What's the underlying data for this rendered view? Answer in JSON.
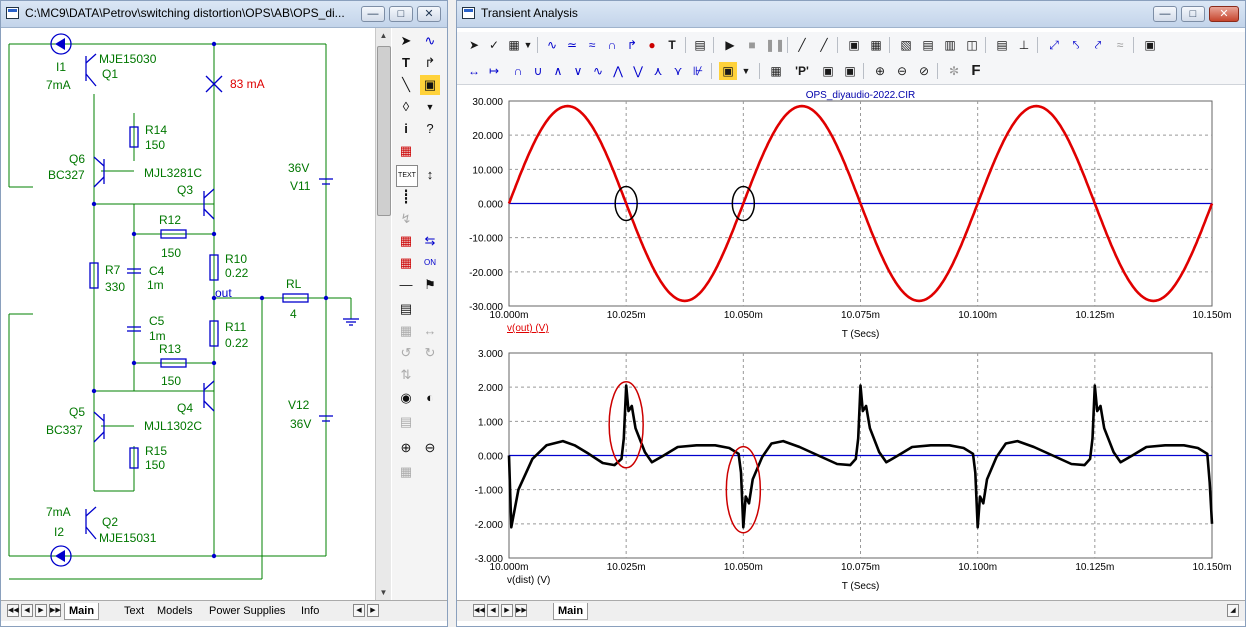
{
  "schematic_window": {
    "title": "C:\\MC9\\DATA\\Petrov\\switching distortion\\OPS\\AB\\OPS_di...",
    "labels": {
      "q1_type": "MJE15030",
      "q1_name": "Q1",
      "i1_name": "I1",
      "i1_value": "7mA",
      "meas_current": "83 mA",
      "r14_name": "R14",
      "r14_value": "150",
      "q6_name": "Q6",
      "q6_type": "BC327",
      "q3_type": "MJL3281C",
      "q3_name": "Q3",
      "v11_value": "36V",
      "v11_name": "V11",
      "r12_name": "R12",
      "r12_value": "150",
      "r10_name": "R10",
      "r10_value": "0.22",
      "r7_name": "R7",
      "r7_value": "330",
      "c4_name": "C4",
      "c4_value": "1m",
      "out_label": "out",
      "rl_name": "RL",
      "rl_value": "4",
      "c5_name": "C5",
      "c5_value": "1m",
      "r11_name": "R11",
      "r11_value": "0.22",
      "r13_name": "R13",
      "r13_value": "150",
      "q4_name": "Q4",
      "q4_type": "MJL1302C",
      "v12_name": "V12",
      "v12_value": "36V",
      "q5_name": "Q5",
      "q5_type": "BC337",
      "r15_name": "R15",
      "r15_value": "150",
      "i2_value": "7mA",
      "i2_name": "I2",
      "q2_name": "Q2",
      "q2_type": "MJE15031"
    },
    "tabs": [
      "Main",
      "Text",
      "Models",
      "Power Supplies",
      "Info"
    ],
    "palette_text_label": "TEXT"
  },
  "analysis_window": {
    "title": "Transient Analysis",
    "tabs": [
      "Main"
    ],
    "toolbar_font_icon": "F",
    "toolbar_p_icon": "'P'"
  },
  "colors": {
    "trace_out": "#e00000",
    "trace_dist": "#000000",
    "axis_zero": "#0000cc",
    "grid": "#999999",
    "schematic_wire": "#008000",
    "schematic_part": "#0000cc"
  },
  "chart_data": [
    {
      "type": "line",
      "title": "OPS_diyaudio-2022.CIR",
      "xlabel": "T (Secs)",
      "ylabel": "v(out) (V)",
      "x_ticks": [
        "10.000m",
        "10.025m",
        "10.050m",
        "10.075m",
        "10.100m",
        "10.125m",
        "10.150m"
      ],
      "y_ticks": [
        "30.000",
        "20.000",
        "10.000",
        "0.000",
        "-10.000",
        "-20.000",
        "-30.000"
      ],
      "xlim_ms": [
        10.0,
        10.15
      ],
      "ylim": [
        -30,
        30
      ],
      "grid": true,
      "series": [
        {
          "name": "v(out) (V)",
          "model": "sine",
          "amplitude_v": 28.5,
          "period_ms": 0.05,
          "zero_crossings_ms": [
            10.0,
            10.025,
            10.05,
            10.075,
            10.1,
            10.125,
            10.15
          ]
        }
      ],
      "annotations": [
        {
          "shape": "ellipse",
          "color": "black",
          "at_ms": 10.025,
          "y": 0
        },
        {
          "shape": "ellipse",
          "color": "black",
          "at_ms": 10.05,
          "y": 0
        }
      ]
    },
    {
      "type": "line",
      "xlabel": "T (Secs)",
      "ylabel": "v(dist) (V)",
      "x_ticks": [
        "10.000m",
        "10.025m",
        "10.050m",
        "10.075m",
        "10.100m",
        "10.125m",
        "10.150m"
      ],
      "y_ticks": [
        "3.000",
        "2.000",
        "1.000",
        "0.000",
        "-1.000",
        "-2.000",
        "-3.000"
      ],
      "xlim_ms": [
        10.0,
        10.15
      ],
      "ylim": [
        -3,
        3
      ],
      "grid": true,
      "series": [
        {
          "name": "v(dist) (V)",
          "points": [
            [
              10.0,
              0.0
            ],
            [
              10.0005,
              -2.1
            ],
            [
              10.002,
              -1.0
            ],
            [
              10.005,
              -0.1
            ],
            [
              10.008,
              0.3
            ],
            [
              10.0115,
              0.42
            ],
            [
              10.014,
              0.3
            ],
            [
              10.017,
              0.05
            ],
            [
              10.02,
              -0.22
            ],
            [
              10.0225,
              -0.28
            ],
            [
              10.024,
              -0.1
            ],
            [
              10.0245,
              0.5
            ],
            [
              10.025,
              2.05
            ],
            [
              10.0255,
              1.3
            ],
            [
              10.0262,
              1.45
            ],
            [
              10.027,
              0.8
            ],
            [
              10.029,
              0.1
            ],
            [
              10.0305,
              -0.2
            ],
            [
              10.033,
              0.0
            ],
            [
              10.036,
              0.25
            ],
            [
              10.04,
              0.3
            ],
            [
              10.044,
              0.3
            ],
            [
              10.047,
              0.22
            ],
            [
              10.049,
              0.05
            ],
            [
              10.0495,
              -0.5
            ],
            [
              10.05,
              -2.1
            ],
            [
              10.0505,
              -1.2
            ],
            [
              10.0512,
              -1.4
            ],
            [
              10.052,
              -0.7
            ],
            [
              10.054,
              -0.05
            ],
            [
              10.056,
              0.35
            ],
            [
              10.0585,
              0.42
            ],
            [
              10.062,
              0.25
            ],
            [
              10.066,
              0.0
            ],
            [
              10.07,
              -0.25
            ],
            [
              10.0728,
              -0.28
            ],
            [
              10.074,
              -0.1
            ],
            [
              10.0745,
              0.5
            ],
            [
              10.075,
              2.05
            ],
            [
              10.0755,
              1.3
            ],
            [
              10.0762,
              1.45
            ],
            [
              10.077,
              0.8
            ],
            [
              10.079,
              0.1
            ],
            [
              10.0805,
              -0.2
            ],
            [
              10.083,
              0.0
            ],
            [
              10.086,
              0.25
            ],
            [
              10.09,
              0.3
            ],
            [
              10.094,
              0.3
            ],
            [
              10.097,
              0.22
            ],
            [
              10.099,
              0.05
            ],
            [
              10.0995,
              -0.5
            ],
            [
              10.1,
              -2.1
            ],
            [
              10.1005,
              -1.2
            ],
            [
              10.1012,
              -1.4
            ],
            [
              10.102,
              -0.7
            ],
            [
              10.104,
              -0.05
            ],
            [
              10.106,
              0.35
            ],
            [
              10.1085,
              0.42
            ],
            [
              10.112,
              0.25
            ],
            [
              10.116,
              0.0
            ],
            [
              10.12,
              -0.25
            ],
            [
              10.1228,
              -0.28
            ],
            [
              10.124,
              -0.1
            ],
            [
              10.1245,
              0.5
            ],
            [
              10.125,
              2.05
            ],
            [
              10.1255,
              1.3
            ],
            [
              10.1262,
              1.45
            ],
            [
              10.127,
              0.8
            ],
            [
              10.129,
              0.1
            ],
            [
              10.1305,
              -0.2
            ],
            [
              10.133,
              0.0
            ],
            [
              10.136,
              0.25
            ],
            [
              10.14,
              0.3
            ],
            [
              10.144,
              0.3
            ],
            [
              10.147,
              0.22
            ],
            [
              10.149,
              0.05
            ],
            [
              10.1495,
              -0.8
            ],
            [
              10.15,
              -2.0
            ]
          ]
        }
      ],
      "annotations": [
        {
          "shape": "ellipse",
          "color": "red",
          "at_ms": 10.025,
          "y": 0.9
        },
        {
          "shape": "ellipse",
          "color": "red",
          "at_ms": 10.05,
          "y": -1.0
        }
      ]
    }
  ]
}
